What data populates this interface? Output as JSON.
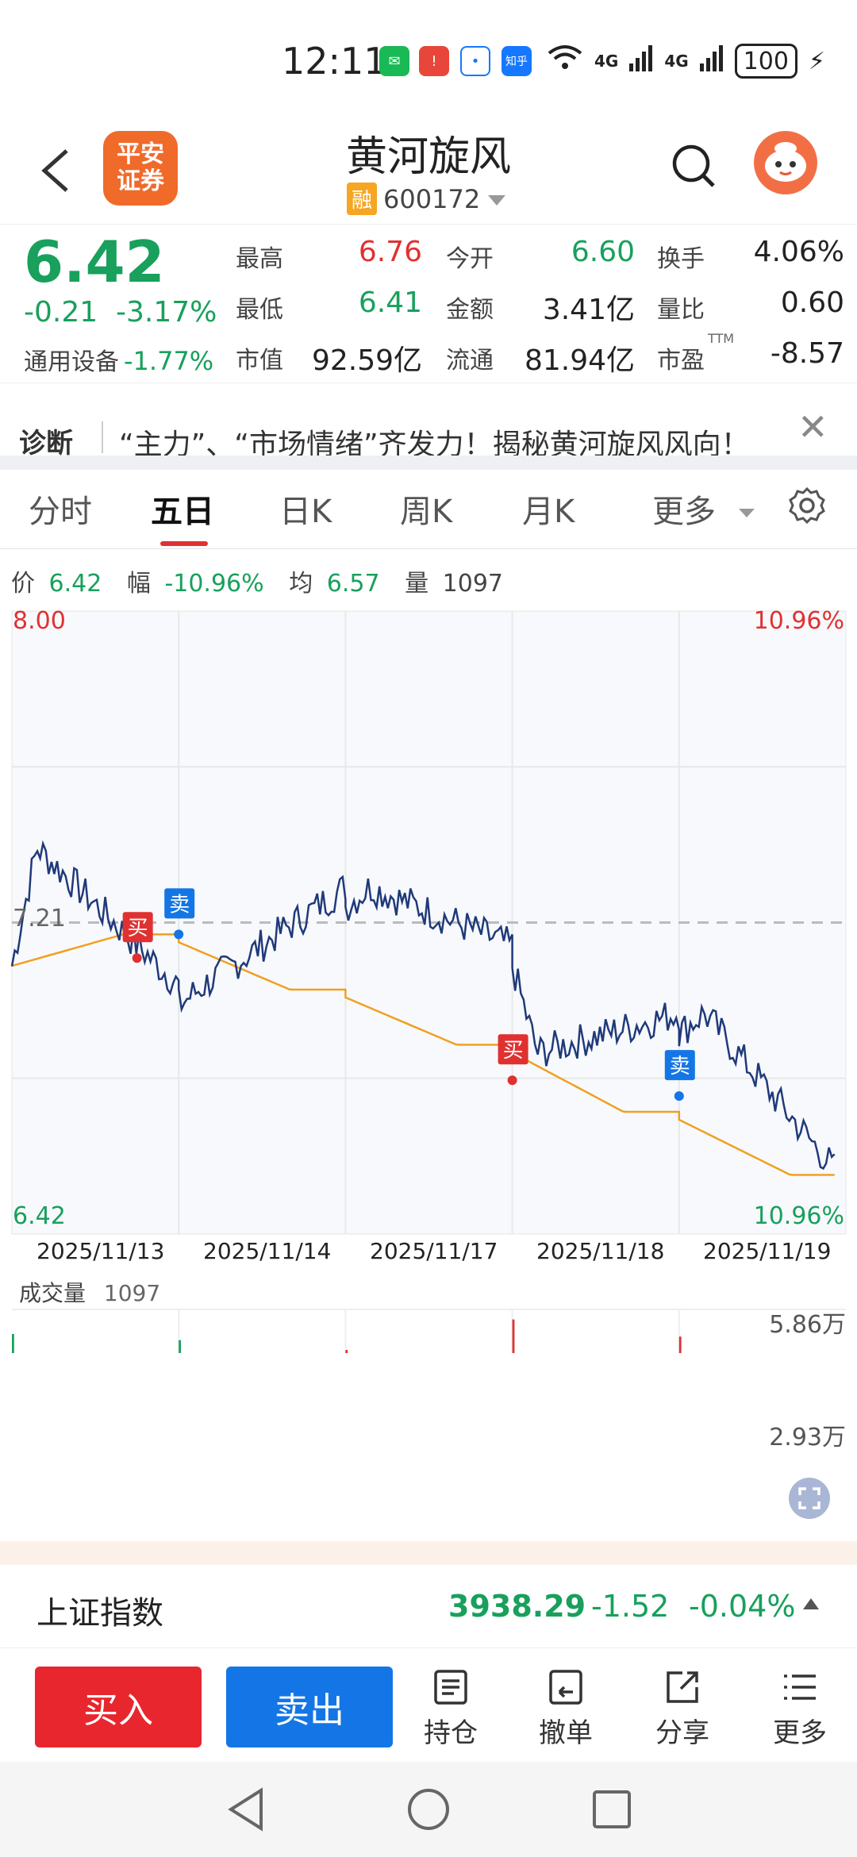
{
  "status_bar": {
    "time": "12:11",
    "battery": "100",
    "signal1": "4G",
    "signal2": "4G",
    "zhihu": "知乎"
  },
  "header": {
    "broker_logo_line1": "平安",
    "broker_logo_line2": "证券",
    "stock_name": "黄河旋风",
    "margin_tag": "融",
    "stock_code": "600172"
  },
  "quote": {
    "price": "6.42",
    "change": "-0.21",
    "change_pct": "-3.17%",
    "sector_name": "通用设备",
    "sector_change": "-1.77%",
    "fields": [
      {
        "label": "最高",
        "value": "6.76"
      },
      {
        "label": "今开",
        "value": "6.60"
      },
      {
        "label": "换手",
        "value": "4.06%"
      },
      {
        "label": "最低",
        "value": "6.41"
      },
      {
        "label": "金额",
        "value": "3.41亿"
      },
      {
        "label": "量比",
        "value": "0.60"
      },
      {
        "label": "市值",
        "value": "92.59亿"
      },
      {
        "label": "流通",
        "value": "81.94亿"
      },
      {
        "label": "市盈",
        "value": "-8.57"
      }
    ],
    "ttm": "TTM"
  },
  "diagnosis": {
    "label": "诊断",
    "text": "“主力”、“市场情绪”齐发力！揭秘黄河旋风风向！"
  },
  "tabs": [
    "分时",
    "五日",
    "日K",
    "周K",
    "月K",
    "更多"
  ],
  "active_tab": "五日",
  "info_line": {
    "price_label": "价",
    "price": "6.42",
    "range_label": "幅",
    "range": "-10.96%",
    "avg_label": "均",
    "avg": "6.57",
    "vol_label": "量",
    "vol": "1097"
  },
  "chart_labels": {
    "ymax": "8.00",
    "ymax_pct": "10.96%",
    "ymid": "7.21",
    "ymin": "6.42",
    "ymin_pct": "10.96%",
    "dates": [
      "2025/11/13",
      "2025/11/14",
      "2025/11/17",
      "2025/11/18",
      "2025/11/19"
    ],
    "buy_mark": "买",
    "sell_mark": "卖",
    "volume_title": "成交量",
    "volume_value": "1097",
    "vol_max": "5.86万",
    "vol_mid": "2.93万"
  },
  "chart_data": {
    "type": "line",
    "x": [
      "2025/11/13",
      "2025/11/14",
      "2025/11/17",
      "2025/11/18",
      "2025/11/19"
    ],
    "ylim": [
      6.42,
      8.0
    ],
    "reference_line": 7.21,
    "series": [
      {
        "values": [
          7.05,
          7.3,
          7.15,
          6.98,
          6.55
        ]
      },
      {
        "values": [
          7.18,
          7.04,
          6.9,
          6.73,
          6.57
        ]
      }
    ],
    "volume_ylim": [
      0,
      58600
    ],
    "grid": true
  },
  "index_bar": {
    "name": "上证指数",
    "value": "3938.29",
    "change": "-1.52",
    "change_pct": "-0.04%"
  },
  "actions": {
    "buy": "买入",
    "sell": "卖出",
    "position": "持仓",
    "cancel": "撤单",
    "share": "分享",
    "more": "更多"
  },
  "colors": {
    "red": "#e03131",
    "green": "#18a05c",
    "blue": "#1476e6",
    "price_line": "#1f3a7a",
    "avg_line": "#f0a020"
  }
}
